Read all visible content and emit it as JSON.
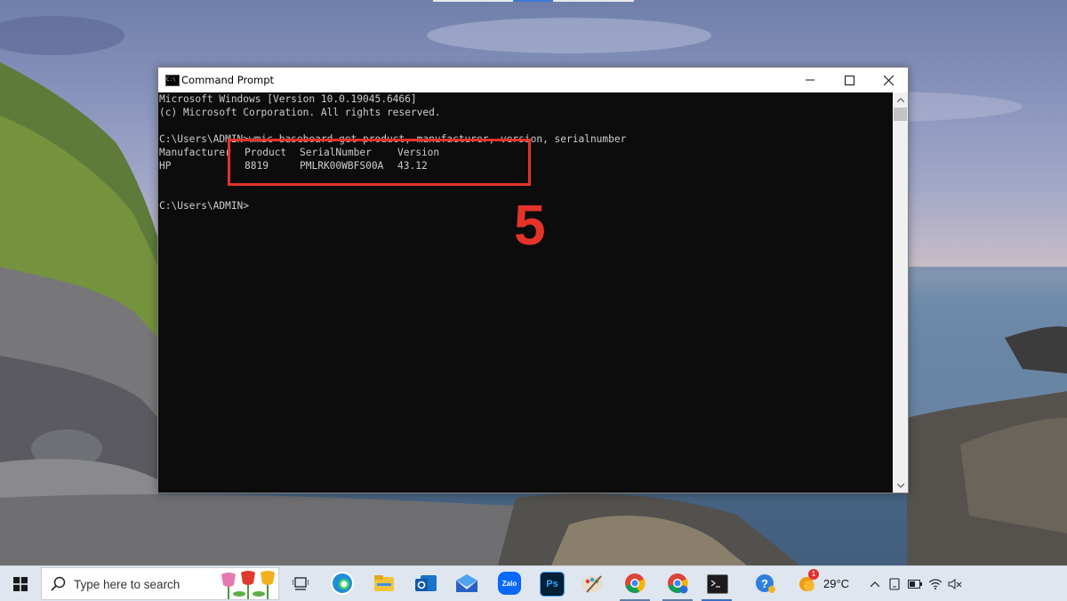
{
  "window": {
    "title": "Command Prompt",
    "controls": {
      "minimize": "—",
      "maximize": "☐",
      "close": "✕"
    },
    "console_lines": [
      "Microsoft Windows [Version 10.0.19045.6466]",
      "(c) Microsoft Corporation. All rights reserved.",
      "",
      "C:\\Users\\ADMIN>wmic baseboard get product, manufacturer, version, serialnumber"
    ],
    "table": {
      "headers": [
        "Manufacturer",
        "Product",
        "SerialNumber",
        "Version"
      ],
      "row": [
        "HP",
        "8819",
        "PMLRK00WBFS00A",
        "43.12"
      ]
    },
    "prompt": "C:\\Users\\ADMIN>"
  },
  "annotation": {
    "step_number": "5",
    "color": "#e5332a"
  },
  "taskbar": {
    "search_placeholder": "Type here to search",
    "temperature": "29°C",
    "weather_badge": "1",
    "pinned_apps": [
      "task-view-icon",
      "edge-icon",
      "file-explorer-icon",
      "outlook-icon",
      "mail-icon",
      "zalo-icon",
      "photoshop-icon",
      "paint-icon",
      "chrome-icon",
      "chrome-profile-icon",
      "command-prompt-icon",
      "help-icon"
    ],
    "app_labels": {
      "zalo": "Zalo",
      "photoshop": "Ps"
    }
  }
}
